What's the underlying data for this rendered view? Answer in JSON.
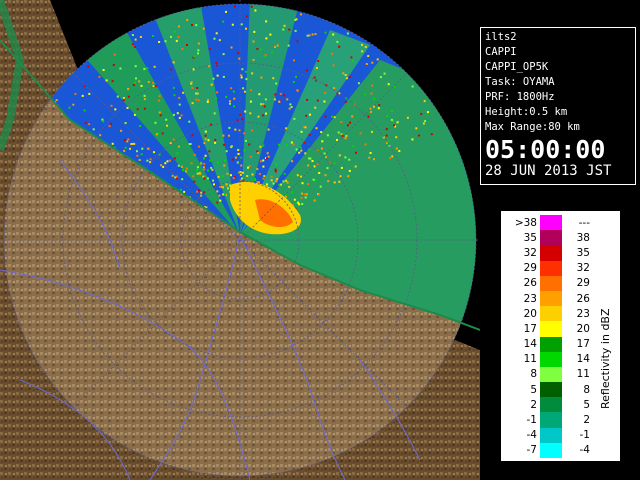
{
  "info": {
    "server": "ilts2",
    "product": "CAPPI",
    "product_code": "CAPPI_OP5K",
    "task": "Task: OYAMA",
    "prf": "PRF: 1800Hz",
    "height": "Height:0.5 km",
    "max_range": "Max Range:80 km",
    "time": "05:00:00",
    "date": "28 JUN 2013 JST"
  },
  "legend": {
    "axis_label": "Reflectivity in dBZ",
    "rows": [
      {
        "lo": ">38",
        "hi": "---",
        "color": "#ff00ff"
      },
      {
        "lo": "35",
        "hi": "38",
        "color": "#b0005a"
      },
      {
        "lo": "32",
        "hi": "35",
        "color": "#d40000"
      },
      {
        "lo": "29",
        "hi": "32",
        "color": "#ff3000"
      },
      {
        "lo": "26",
        "hi": "29",
        "color": "#ff7000"
      },
      {
        "lo": "23",
        "hi": "26",
        "color": "#ffa000"
      },
      {
        "lo": "20",
        "hi": "23",
        "color": "#ffd000"
      },
      {
        "lo": "17",
        "hi": "20",
        "color": "#ffff00"
      },
      {
        "lo": "14",
        "hi": "17",
        "color": "#00a000"
      },
      {
        "lo": "11",
        "hi": "14",
        "color": "#00d800"
      },
      {
        "lo": "8",
        "hi": "11",
        "color": "#80ff40"
      },
      {
        "lo": "5",
        "hi": "8",
        "color": "#006000"
      },
      {
        "lo": "2",
        "hi": "5",
        "color": "#008c3c"
      },
      {
        "lo": "-1",
        "hi": "2",
        "color": "#00a878"
      },
      {
        "lo": "-4",
        "hi": "-1",
        "color": "#00c8c8"
      },
      {
        "lo": "-7",
        "hi": "-4",
        "color": "#00ffff"
      }
    ]
  },
  "colors": {
    "ocean": "#1a57d6",
    "land": "#6b4e2e",
    "terrain_light": "#9a7b55",
    "coast": "#1e8a4a",
    "river": "#6a6ad8"
  }
}
